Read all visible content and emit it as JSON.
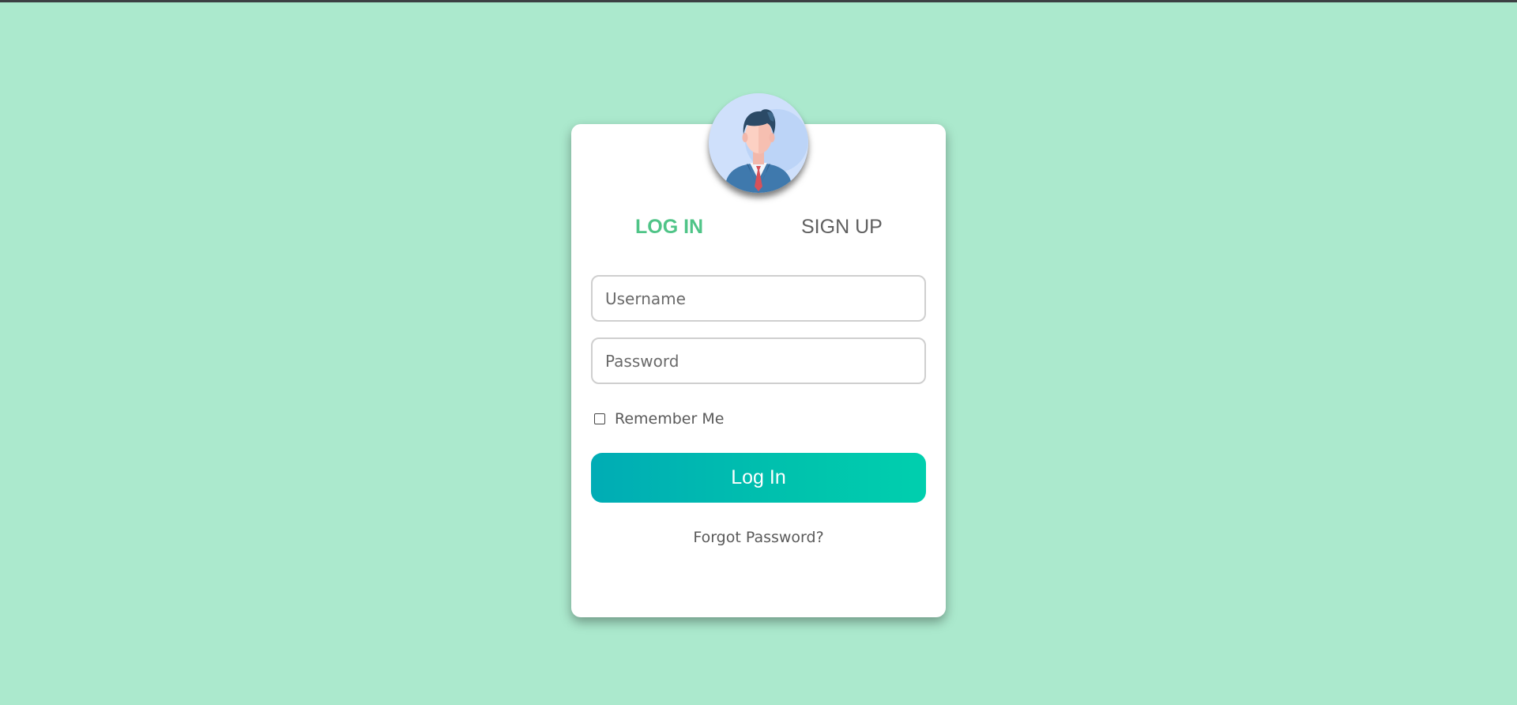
{
  "tabs": {
    "login_label": "LOG IN",
    "signup_label": "SIGN UP",
    "active": "login"
  },
  "form": {
    "username_placeholder": "Username",
    "password_placeholder": "Password",
    "remember_label": "Remember Me",
    "remember_checked": false,
    "submit_label": "Log In",
    "forgot_label": "Forgot Password?"
  },
  "avatar": {
    "icon": "user-avatar-icon"
  },
  "colors": {
    "background": "#abe9cd",
    "card": "#ffffff",
    "accent": "#4fc487",
    "button_gradient_start": "#00acb5",
    "button_gradient_end": "#00cfae"
  }
}
